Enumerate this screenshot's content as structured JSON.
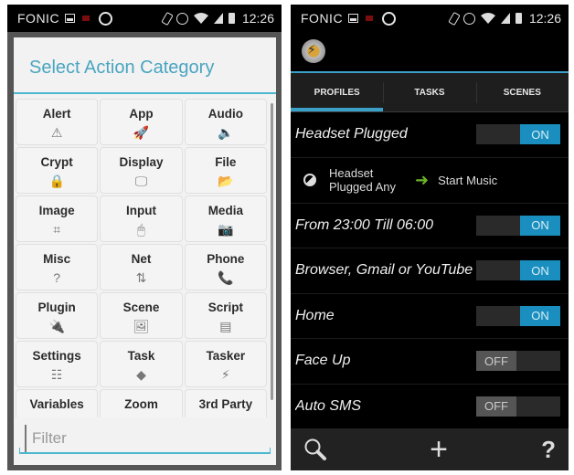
{
  "status_bar": {
    "carrier": "FONIC",
    "time": "12:26",
    "icons": [
      "picture-icon",
      "notification-badge-icon",
      "whatsapp-icon",
      "rotate-icon",
      "alarm-icon",
      "wifi-icon",
      "signal-icon",
      "battery-icon"
    ]
  },
  "left": {
    "dialog": {
      "title": "Select Action Category",
      "categories": [
        {
          "label": "Alert",
          "icon": "⚠",
          "icon_name": "alert-icon"
        },
        {
          "label": "App",
          "icon": "🚀",
          "icon_name": "rocket-icon"
        },
        {
          "label": "Audio",
          "icon": "🔈",
          "icon_name": "speaker-icon"
        },
        {
          "label": "Crypt",
          "icon": "🔒",
          "icon_name": "lock-icon"
        },
        {
          "label": "Display",
          "icon": "🖵",
          "icon_name": "monitor-icon"
        },
        {
          "label": "File",
          "icon": "📂",
          "icon_name": "folder-icon"
        },
        {
          "label": "Image",
          "icon": "⌗",
          "icon_name": "crop-icon"
        },
        {
          "label": "Input",
          "icon": "🖱",
          "icon_name": "mouse-icon"
        },
        {
          "label": "Media",
          "icon": "📷",
          "icon_name": "camera-icon"
        },
        {
          "label": "Misc",
          "icon": "?",
          "icon_name": "question-icon"
        },
        {
          "label": "Net",
          "icon": "⇅",
          "icon_name": "updown-arrows-icon"
        },
        {
          "label": "Phone",
          "icon": "📞",
          "icon_name": "phone-icon"
        },
        {
          "label": "Plugin",
          "icon": "🔌",
          "icon_name": "plug-icon"
        },
        {
          "label": "Scene",
          "icon": "🖼",
          "icon_name": "picture-icon"
        },
        {
          "label": "Script",
          "icon": "▤",
          "icon_name": "script-icon"
        },
        {
          "label": "Settings",
          "icon": "☷",
          "icon_name": "sliders-icon"
        },
        {
          "label": "Task",
          "icon": "◆",
          "icon_name": "task-icon"
        },
        {
          "label": "Tasker",
          "icon": "⚡",
          "icon_name": "lightning-icon"
        },
        {
          "label": "Variables",
          "icon": "",
          "icon_name": "variables-icon"
        },
        {
          "label": "Zoom",
          "icon": "",
          "icon_name": "zoom-icon"
        },
        {
          "label": "3rd Party",
          "icon": "",
          "icon_name": "third-party-icon"
        }
      ],
      "filter_placeholder": "Filter",
      "filter_value": ""
    }
  },
  "right": {
    "tabs": [
      {
        "label": "PROFILES",
        "active": true
      },
      {
        "label": "TASKS",
        "active": false
      },
      {
        "label": "SCENES",
        "active": false
      }
    ],
    "profiles": [
      {
        "name": "Headset Plugged",
        "state": "ON",
        "on": true,
        "expanded": {
          "context": "Headset Plugged Any",
          "task": "Start Music"
        }
      },
      {
        "name": "From 23:00 Till 06:00",
        "state": "ON",
        "on": true
      },
      {
        "name": "Browser, Gmail or YouTube",
        "state": "ON",
        "on": true
      },
      {
        "name": "Home",
        "state": "ON",
        "on": true
      },
      {
        "name": "Face Up",
        "state": "OFF",
        "on": false
      },
      {
        "name": "Auto SMS",
        "state": "OFF",
        "on": false
      }
    ],
    "bottom_bar": {
      "search": "search-icon",
      "add": "+",
      "help": "?"
    }
  },
  "colors": {
    "accent_blue": "#3aa0c8",
    "toggle_on": "#1a8fbf",
    "dialog_title": "#4aa5c0",
    "arrow_green": "#6ab42a"
  }
}
